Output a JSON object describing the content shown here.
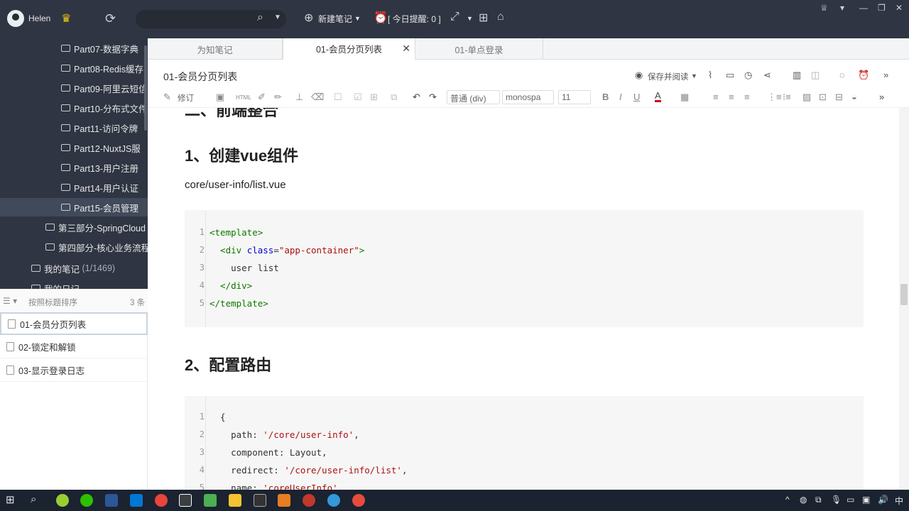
{
  "app": {
    "user": "Helen",
    "new_note": "新建笔记",
    "reminder": "[ 今日提醒: 0 ]"
  },
  "tree": {
    "items": [
      {
        "label": "Part07-数据字典"
      },
      {
        "label": "Part08-Redis缓存"
      },
      {
        "label": "Part09-阿里云短信"
      },
      {
        "label": "Part10-分布式文件"
      },
      {
        "label": "Part11-访问令牌"
      },
      {
        "label": "Part12-NuxtJS服"
      },
      {
        "label": "Part13-用户注册"
      },
      {
        "label": "Part14-用户认证"
      },
      {
        "label": "Part15-会员管理"
      },
      {
        "label": "第三部分-SpringCloud"
      },
      {
        "label": "第四部分-核心业务流程"
      },
      {
        "label": "我的笔记",
        "count": "(1/1469)"
      },
      {
        "label": "我的日记"
      }
    ]
  },
  "list": {
    "sort_label": "按照标题排序",
    "count": "3 条",
    "notes": [
      {
        "label": "01-会员分页列表"
      },
      {
        "label": "02-锁定和解锁"
      },
      {
        "label": "03-显示登录日志"
      }
    ]
  },
  "tabs": [
    {
      "label": "为知笔记"
    },
    {
      "label": "01-会员分页列表"
    },
    {
      "label": "01-单点登录"
    }
  ],
  "doc": {
    "title": "01-会员分页列表",
    "save_read": "保存并阅读",
    "revise": "修订",
    "format_select": "普通 (div)",
    "font_select": "monospa",
    "size_select": "11",
    "heading_top": "二、前端整合",
    "h1": "1、创建vue组件",
    "path": "core/user-info/list.vue",
    "code1": [
      {
        "n": "1",
        "a": "<template>"
      },
      {
        "n": "2",
        "a": "  <div ",
        "b": "class",
        "c": "=",
        "d": "\"app-container\"",
        "e": ">"
      },
      {
        "n": "3",
        "a": "    user list"
      },
      {
        "n": "4",
        "a": "  </div>"
      },
      {
        "n": "5",
        "a": "</template>"
      }
    ],
    "h2": "2、配置路由",
    "code2": [
      {
        "n": "1",
        "a": "  {"
      },
      {
        "n": "2",
        "a": "    path: ",
        "s": "'/core/user-info'",
        "e": ","
      },
      {
        "n": "3",
        "a": "    component: Layout,"
      },
      {
        "n": "4",
        "a": "    redirect: ",
        "s": "'/core/user-info/list'",
        "e": ","
      },
      {
        "n": "5",
        "a": "    name: ",
        "s": "'coreUserInfo'",
        "e": ","
      }
    ]
  },
  "taskbar": {
    "time": "中"
  }
}
